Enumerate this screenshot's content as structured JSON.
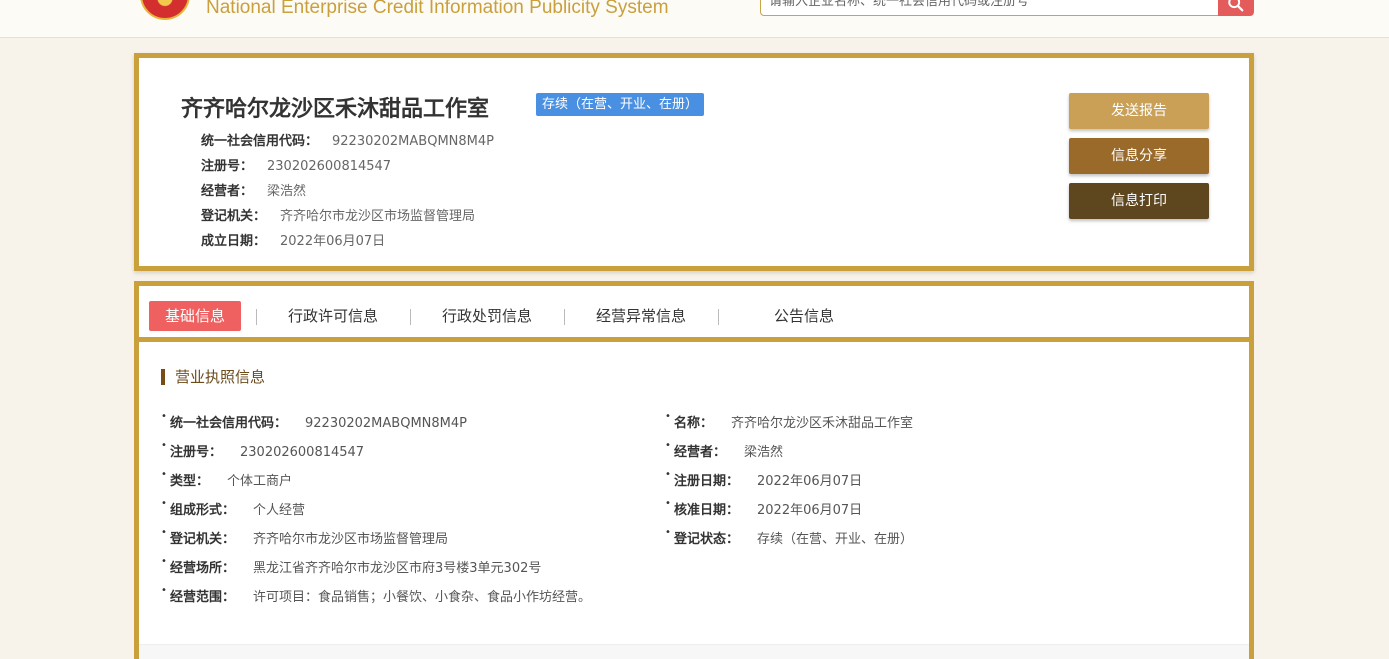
{
  "header": {
    "title": "National Enterprise Credit Information Publicity System",
    "search_placeholder": "请输入企业名称、统一社会信用代码或注册号"
  },
  "summary": {
    "company_name": "齐齐哈尔龙沙区禾沐甜品工作室",
    "status_tag": "存续（在营、开业、在册）",
    "fields": [
      {
        "label": "统一社会信用代码：",
        "value": "92230202MABQMN8M4P"
      },
      {
        "label": "注册号：",
        "value": "230202600814547"
      },
      {
        "label": "经营者：",
        "value": "梁浩然"
      },
      {
        "label": "登记机关：",
        "value": "齐齐哈尔市龙沙区市场监督管理局"
      },
      {
        "label": "成立日期：",
        "value": "2022年06月07日"
      }
    ],
    "buttons": {
      "send_report": "发送报告",
      "share": "信息分享",
      "print": "信息打印"
    }
  },
  "tabs": [
    "基础信息",
    "行政许可信息",
    "行政处罚信息",
    "经营异常信息",
    "公告信息"
  ],
  "license": {
    "section_title": "营业执照信息",
    "left": [
      {
        "label": "统一社会信用代码：",
        "value": "92230202MABQMN8M4P"
      },
      {
        "label": "注册号：",
        "value": "230202600814547"
      },
      {
        "label": "类型：",
        "value": "个体工商户"
      },
      {
        "label": "组成形式：",
        "value": "个人经营"
      },
      {
        "label": "登记机关：",
        "value": "齐齐哈尔市龙沙区市场监督管理局"
      },
      {
        "label": "经营场所：",
        "value": "黑龙江省齐齐哈尔市龙沙区市府3号楼3单元302号"
      },
      {
        "label": "经营范围：",
        "value": "许可项目：食品销售；小餐饮、小食杂、食品小作坊经营。"
      }
    ],
    "right": [
      {
        "label": "名称：",
        "value": "齐齐哈尔龙沙区禾沐甜品工作室"
      },
      {
        "label": "经营者：",
        "value": "梁浩然"
      },
      {
        "label": "注册日期：",
        "value": "2022年06月07日"
      },
      {
        "label": "核准日期：",
        "value": "2022年06月07日"
      },
      {
        "label": "登记状态：",
        "value": "存续（在营、开业、在册）"
      }
    ]
  },
  "colors": {
    "border_gold": "#c9a03c",
    "btn_send": "#c9a056",
    "btn_share": "#9a6a2a",
    "btn_print": "#5e461f",
    "tab_active": "#ef6060",
    "status_blue": "#4a90e2"
  }
}
